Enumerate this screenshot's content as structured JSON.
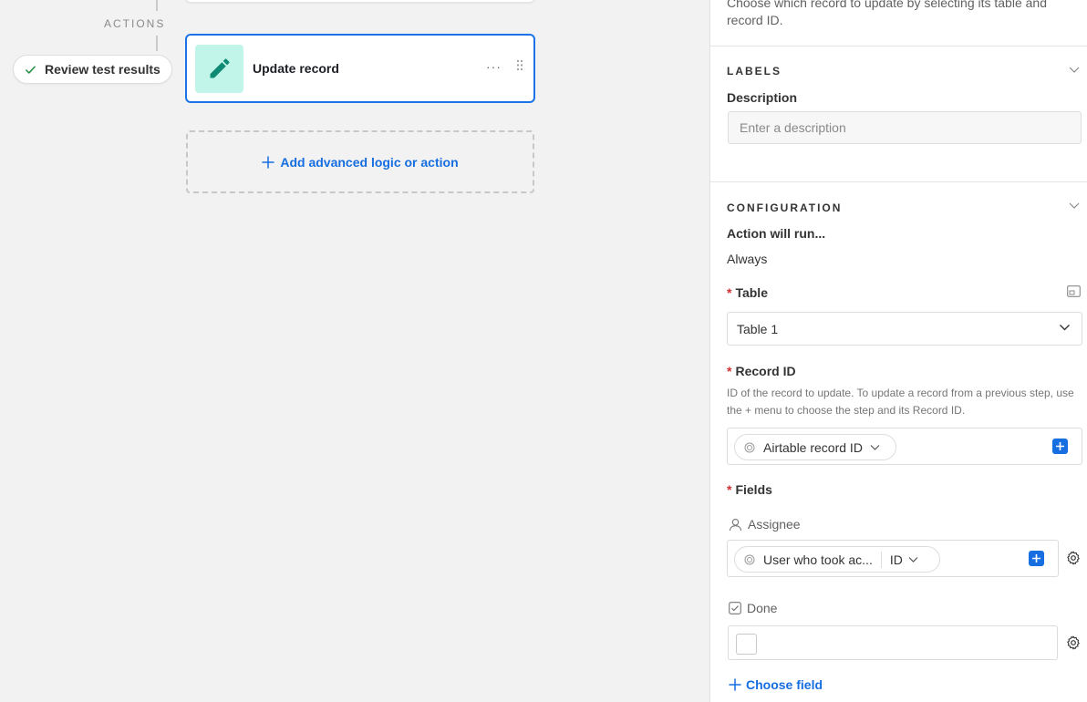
{
  "canvas": {
    "actions_label": "ACTIONS",
    "review_button": "Review test results",
    "action_card": {
      "title": "Update record",
      "more": "···"
    },
    "add_logic": "Add advanced logic or action"
  },
  "panel": {
    "description": "Choose which record to update by selecting its table and record ID.",
    "labels_section": {
      "title": "LABELS",
      "description_label": "Description",
      "description_placeholder": "Enter a description"
    },
    "configuration": {
      "title": "CONFIGURATION",
      "run_label": "Action will run...",
      "run_value": "Always",
      "table_label": "Table",
      "table_value": "Table 1",
      "record_id_label": "Record ID",
      "record_id_help": "ID of the record to update. To update a record from a previous step, use the + menu to choose the step and its Record ID.",
      "record_id_token": "Airtable record ID",
      "fields_label": "Fields",
      "assignee_label": "Assignee",
      "assignee_token": "User who took ac...",
      "assignee_subtoken": "ID",
      "done_label": "Done",
      "choose_field": "Choose field",
      "required_mark": "*"
    }
  },
  "colors": {
    "accent": "#166ee1",
    "selected_border": "#1a73e8",
    "required": "#d32f2f",
    "action_icon_bg": "#c2f5e9",
    "action_icon": "#0f8a74"
  },
  "icons": [
    "check-icon",
    "pencil-icon",
    "more-icon",
    "drag-handle-icon",
    "plus-icon",
    "chevron-down-icon",
    "expand-icon",
    "token-icon",
    "user-icon",
    "checkbox-icon",
    "gear-icon"
  ]
}
